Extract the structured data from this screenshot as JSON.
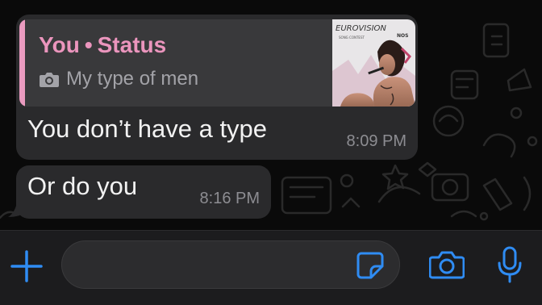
{
  "colors": {
    "accent": "#2f8cf3",
    "bubble_bg": "#2a2a2c",
    "quote_bg": "#39393b",
    "quote_bar": "#ea9bc0",
    "quote_title": "#eb95bd"
  },
  "messages": [
    {
      "reply": {
        "author": "You",
        "separator": "•",
        "source": "Status",
        "media_icon": "camera-icon",
        "caption": "My type of men",
        "thumbnail": {
          "top_text": "EUROVISION",
          "sub_text": "SONG CONTEST",
          "side_text": "NOS"
        }
      },
      "text": "You don’t have a type",
      "time": "8:09 PM"
    },
    {
      "text": "Or do you",
      "time": "8:16 PM"
    }
  ],
  "input_bar": {
    "placeholder": "",
    "icons": [
      "plus-icon",
      "sticker-icon",
      "camera-icon",
      "microphone-icon"
    ]
  }
}
